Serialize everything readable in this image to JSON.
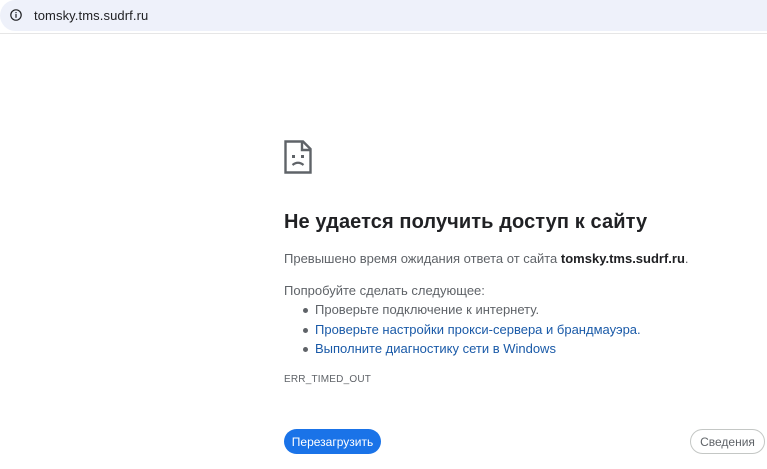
{
  "address_bar": {
    "icon": "info-icon",
    "url": "tomsky.tms.sudrf.ru"
  },
  "error_page": {
    "icon": "sad-page-icon",
    "title": "Не удается получить доступ к сайту",
    "description_prefix": "Превышено время ожидания ответа от сайта ",
    "description_host": "tomsky.tms.sudrf.ru",
    "description_suffix": ".",
    "try_label": "Попробуйте сделать следующее:",
    "suggestions": [
      {
        "text": "Проверьте подключение к интернету.",
        "is_link": false
      },
      {
        "text": "Проверьте настройки прокси-сервера и брандмауэра.",
        "is_link": true
      },
      {
        "text": "Выполните диагностику сети в Windows",
        "is_link": true
      }
    ],
    "error_code": "ERR_TIMED_OUT"
  },
  "buttons": {
    "reload_label": "Перезагрузить",
    "details_label": "Сведения"
  },
  "colors": {
    "accent": "#1a73e8",
    "link": "#1a5aa8",
    "text_secondary": "#5f6368",
    "address_bar_bg": "#eef1fa"
  }
}
